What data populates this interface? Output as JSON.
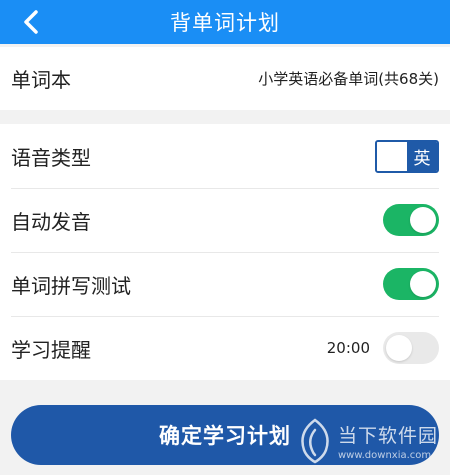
{
  "header": {
    "title": "背单词计划",
    "back_icon": "chevron-left-icon"
  },
  "wordbook": {
    "label": "单词本",
    "value": "小学英语必备单词(共68关)"
  },
  "settings": {
    "voice": {
      "label": "语音类型",
      "option": "英"
    },
    "auto_pronounce": {
      "label": "自动发音",
      "enabled": true
    },
    "spelling_test": {
      "label": "单词拼写测试",
      "enabled": true
    },
    "reminder": {
      "label": "学习提醒",
      "time": "20:00",
      "enabled": false
    }
  },
  "confirm_button": {
    "label": "确定学习计划"
  },
  "watermark": {
    "text": "当下软件园",
    "url": "www.downxia.com"
  },
  "colors": {
    "header": "#1a8ef5",
    "switch_on": "#1bb565",
    "switch_off": "#e9e9e9",
    "button": "#1f58a8",
    "toggle_border": "#1f5aa8"
  }
}
